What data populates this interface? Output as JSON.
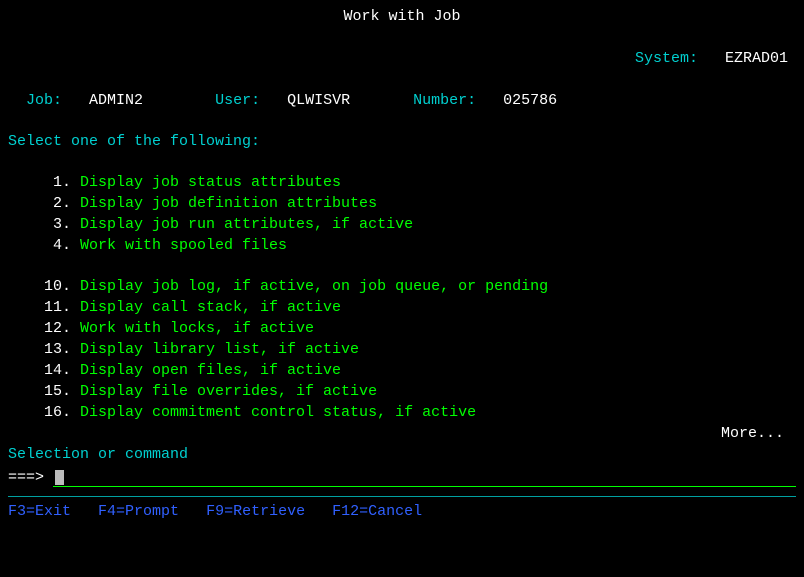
{
  "title": "Work with Job",
  "system": {
    "label": "System:",
    "value": "EZRAD01"
  },
  "job": {
    "label": "Job:",
    "value": "ADMIN2"
  },
  "user": {
    "label": "User:",
    "value": "QLWISVR"
  },
  "number": {
    "label": "Number:",
    "value": "025786"
  },
  "instruction": "Select one of the following:",
  "menu": [
    {
      "num": "1",
      "text": "Display job status attributes"
    },
    {
      "num": "2",
      "text": "Display job definition attributes"
    },
    {
      "num": "3",
      "text": "Display job run attributes, if active"
    },
    {
      "num": "4",
      "text": "Work with spooled files"
    },
    {
      "num": "10",
      "text": "Display job log, if active, on job queue, or pending"
    },
    {
      "num": "11",
      "text": "Display call stack, if active"
    },
    {
      "num": "12",
      "text": "Work with locks, if active"
    },
    {
      "num": "13",
      "text": "Display library list, if active"
    },
    {
      "num": "14",
      "text": "Display open files, if active"
    },
    {
      "num": "15",
      "text": "Display file overrides, if active"
    },
    {
      "num": "16",
      "text": "Display commitment control status, if active"
    }
  ],
  "more": "More...",
  "command_label": "Selection or command",
  "prompt": "===> ",
  "command_value": "",
  "fkeys": [
    {
      "key": "F3",
      "text": "Exit"
    },
    {
      "key": "F4",
      "text": "Prompt"
    },
    {
      "key": "F9",
      "text": "Retrieve"
    },
    {
      "key": "F12",
      "text": "Cancel"
    }
  ],
  "colors": {
    "green": "#00ff00",
    "cyan": "#00d0d0",
    "white": "#ffffff",
    "blue": "#3060ff",
    "bg": "#000000"
  }
}
